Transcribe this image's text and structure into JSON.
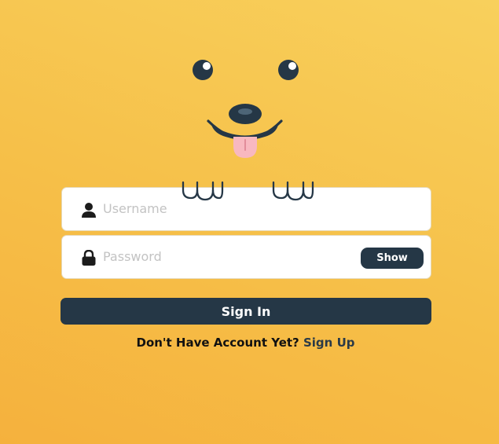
{
  "form": {
    "username_placeholder": "Username",
    "password_placeholder": "Password",
    "show_label": "Show",
    "signin_label": "Sign In",
    "no_account_text": "Don't Have Account Yet?",
    "signup_label": "Sign Up"
  },
  "icons": {
    "username": "user-icon",
    "password": "lock-icon"
  },
  "colors": {
    "background_top": "#f8d05c",
    "background_bottom": "#f5b13d",
    "dark": "#253746",
    "tongue": "#f8b8c0",
    "field": "#ffffff"
  }
}
